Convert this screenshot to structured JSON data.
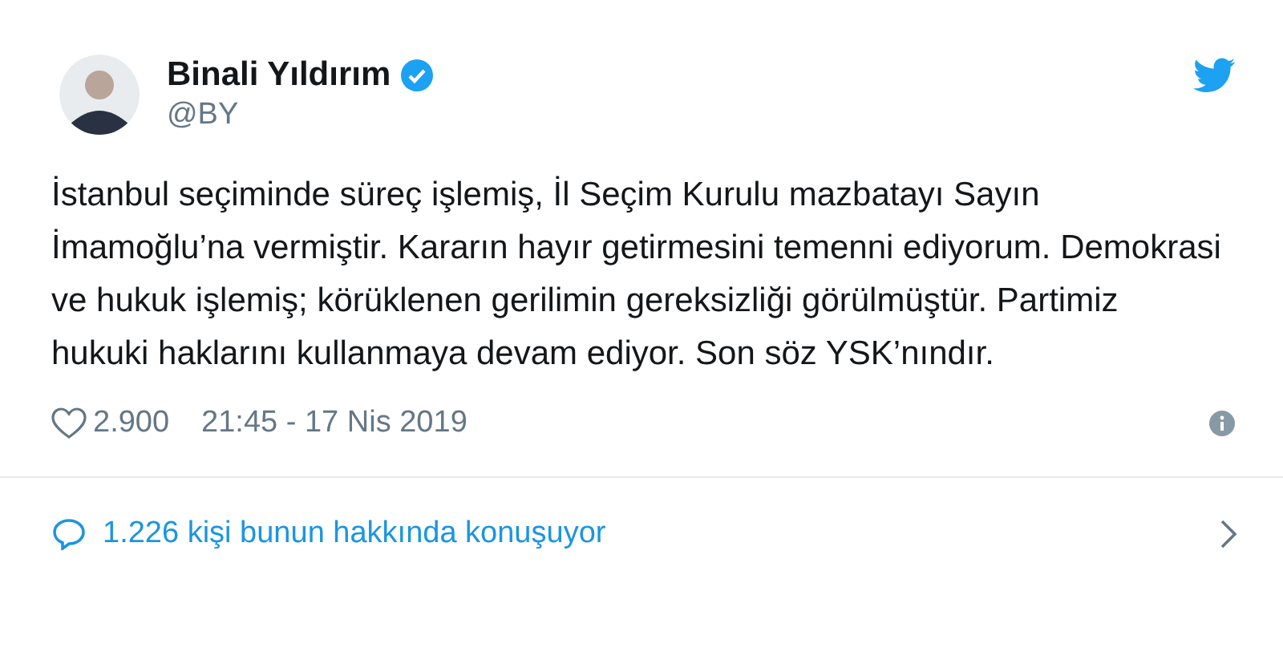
{
  "author": {
    "name": "Binali Yıldırım",
    "verified": true,
    "handle": "@BY"
  },
  "tweet": {
    "text": "İstanbul seçiminde süreç işlemiş, İl Seçim Kurulu mazbatayı Sayın İmamoğlu’na vermiştir. Kararın hayır getirmesini temenni ediyorum. Demokrasi ve hukuk işlemiş; körüklenen gerilimin gereksizliği görülmüştür. Partimiz hukuki haklarını kullanmaya devam ediyor. Son söz YSK’nındır."
  },
  "footer": {
    "likes": "2.900",
    "timestamp": "21:45 - 17 Nis 2019"
  },
  "conversation": {
    "label": "1.226 kişi bunun hakkında konuşuyor"
  }
}
